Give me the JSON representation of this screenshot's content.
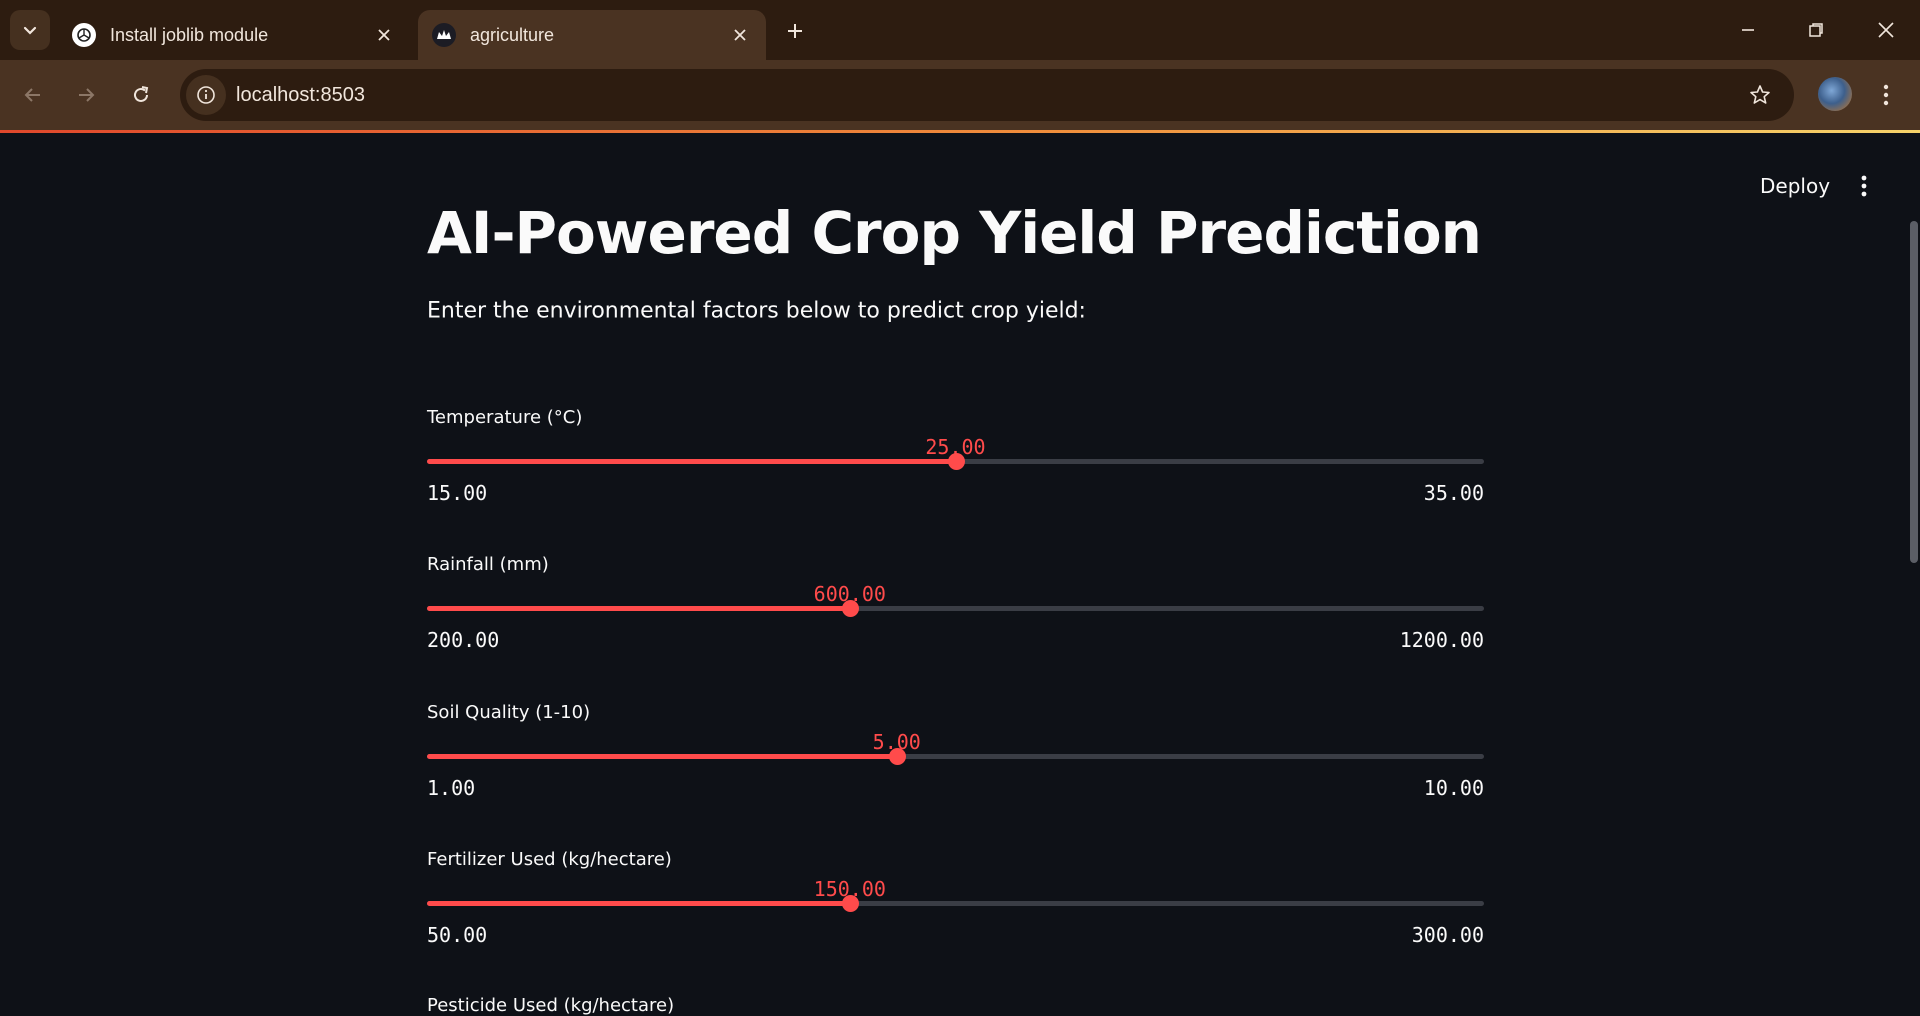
{
  "browser": {
    "tabs": [
      {
        "title": "Install joblib module",
        "icon": "openai-swirl-icon",
        "active": false
      },
      {
        "title": "agriculture",
        "icon": "streamlit-crown-icon",
        "active": true
      }
    ],
    "url": "localhost:8503"
  },
  "app": {
    "deploy_label": "Deploy",
    "title": "AI-Powered Crop Yield Prediction",
    "subtitle": "Enter the environmental factors below to predict crop yield:",
    "accent_color": "#ff4b4b",
    "sliders": [
      {
        "label": "Temperature (°C)",
        "min": 15,
        "max": 35,
        "value": 25,
        "min_label": "15.00",
        "max_label": "35.00",
        "value_label": "25.00"
      },
      {
        "label": "Rainfall (mm)",
        "min": 200,
        "max": 1200,
        "value": 600,
        "min_label": "200.00",
        "max_label": "1200.00",
        "value_label": "600.00"
      },
      {
        "label": "Soil Quality (1-10)",
        "min": 1,
        "max": 10,
        "value": 5,
        "min_label": "1.00",
        "max_label": "10.00",
        "value_label": "5.00"
      },
      {
        "label": "Fertilizer Used (kg/hectare)",
        "min": 50,
        "max": 300,
        "value": 150,
        "min_label": "50.00",
        "max_label": "300.00",
        "value_label": "150.00"
      }
    ],
    "next_label": "Pesticide Used (kg/hectare)"
  }
}
